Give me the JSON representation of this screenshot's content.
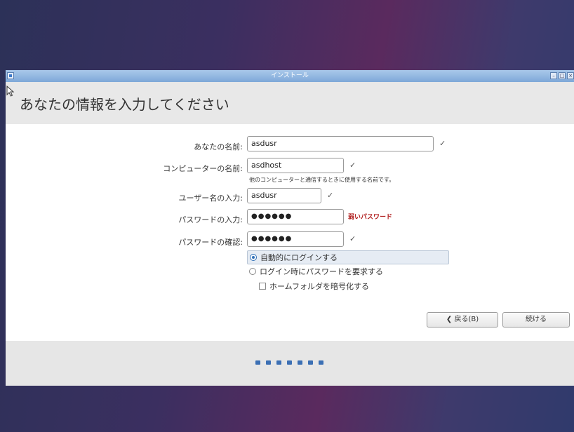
{
  "window": {
    "title": "インストール",
    "controls": [
      "minimize",
      "maximize",
      "close"
    ]
  },
  "header": {
    "title": "あなたの情報を入力してください"
  },
  "form": {
    "your_name_label": "あなたの名前:",
    "your_name_value": "asdusr",
    "computer_name_label": "コンピューターの名前:",
    "computer_name_value": "asdhost",
    "computer_name_hint": "他のコンピューターと通信するときに使用する名前です。",
    "username_label": "ユーザー名の入力:",
    "username_value": "asdusr",
    "password_label": "パスワードの入力:",
    "password_value": "●●●●●●",
    "password_strength": "弱いパスワード",
    "confirm_label": "パスワードの確認:",
    "confirm_value": "●●●●●●",
    "checkmark": "✓",
    "login_auto": "自動的にログインする",
    "login_require_password": "ログイン時にパスワードを要求する",
    "encrypt_home": "ホームフォルダを暗号化する",
    "login_mode_selected": "auto",
    "encrypt_home_checked": false
  },
  "buttons": {
    "back_label": "戻る(B)",
    "back_icon": "chevron-left-icon",
    "continue_label": "続ける"
  },
  "progress": {
    "steps": 7
  },
  "colors": {
    "accent": "#3b6fb4",
    "weak_password": "#b01c1c"
  }
}
